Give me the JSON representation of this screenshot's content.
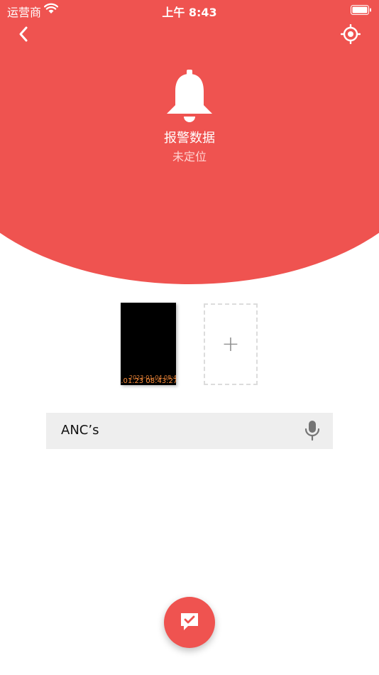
{
  "status_bar": {
    "carrier": "运营商",
    "time": "上午 8:43"
  },
  "header": {
    "title": "报警数据",
    "subtitle": "未定位",
    "accent_color": "#ef5350"
  },
  "icons": {
    "back": "chevron-left-icon",
    "locate": "locate-icon",
    "bell": "bell-icon",
    "add": "plus-icon",
    "mic": "microphone-icon",
    "submit": "message-check-icon"
  },
  "photos": {
    "thumbnail_timestamp_overlay_1": "2023-01-04 08:4",
    "thumbnail_timestamp_overlay_2": "4.01.23 08:43:27",
    "add_label": "+"
  },
  "description_input": {
    "value": "ANC’s"
  }
}
